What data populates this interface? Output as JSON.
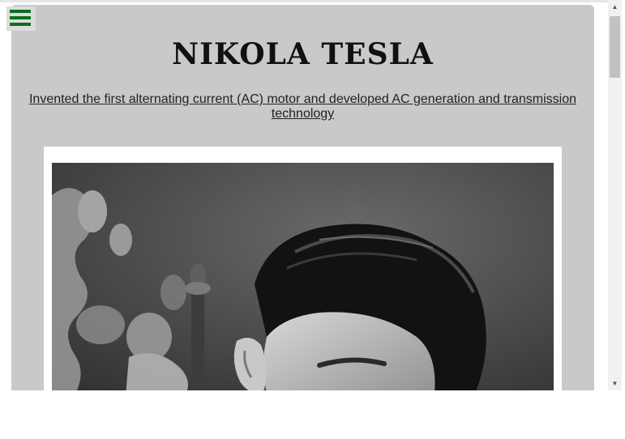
{
  "page": {
    "title": "NIKOLA TESLA",
    "subtitle": "Invented the first alternating current (AC) motor and developed AC generation and transmission technology"
  },
  "menu": {
    "icon": "hamburger-icon",
    "color": "#0b6e1f"
  },
  "photo": {
    "description_icon": "portrait-photo"
  },
  "scrollbar": {
    "up_icon": "▲",
    "down_icon": "▼"
  },
  "colors": {
    "card_background": "#c9c9c9",
    "title_text": "#111111",
    "menu_accent": "#0b6e1f"
  }
}
